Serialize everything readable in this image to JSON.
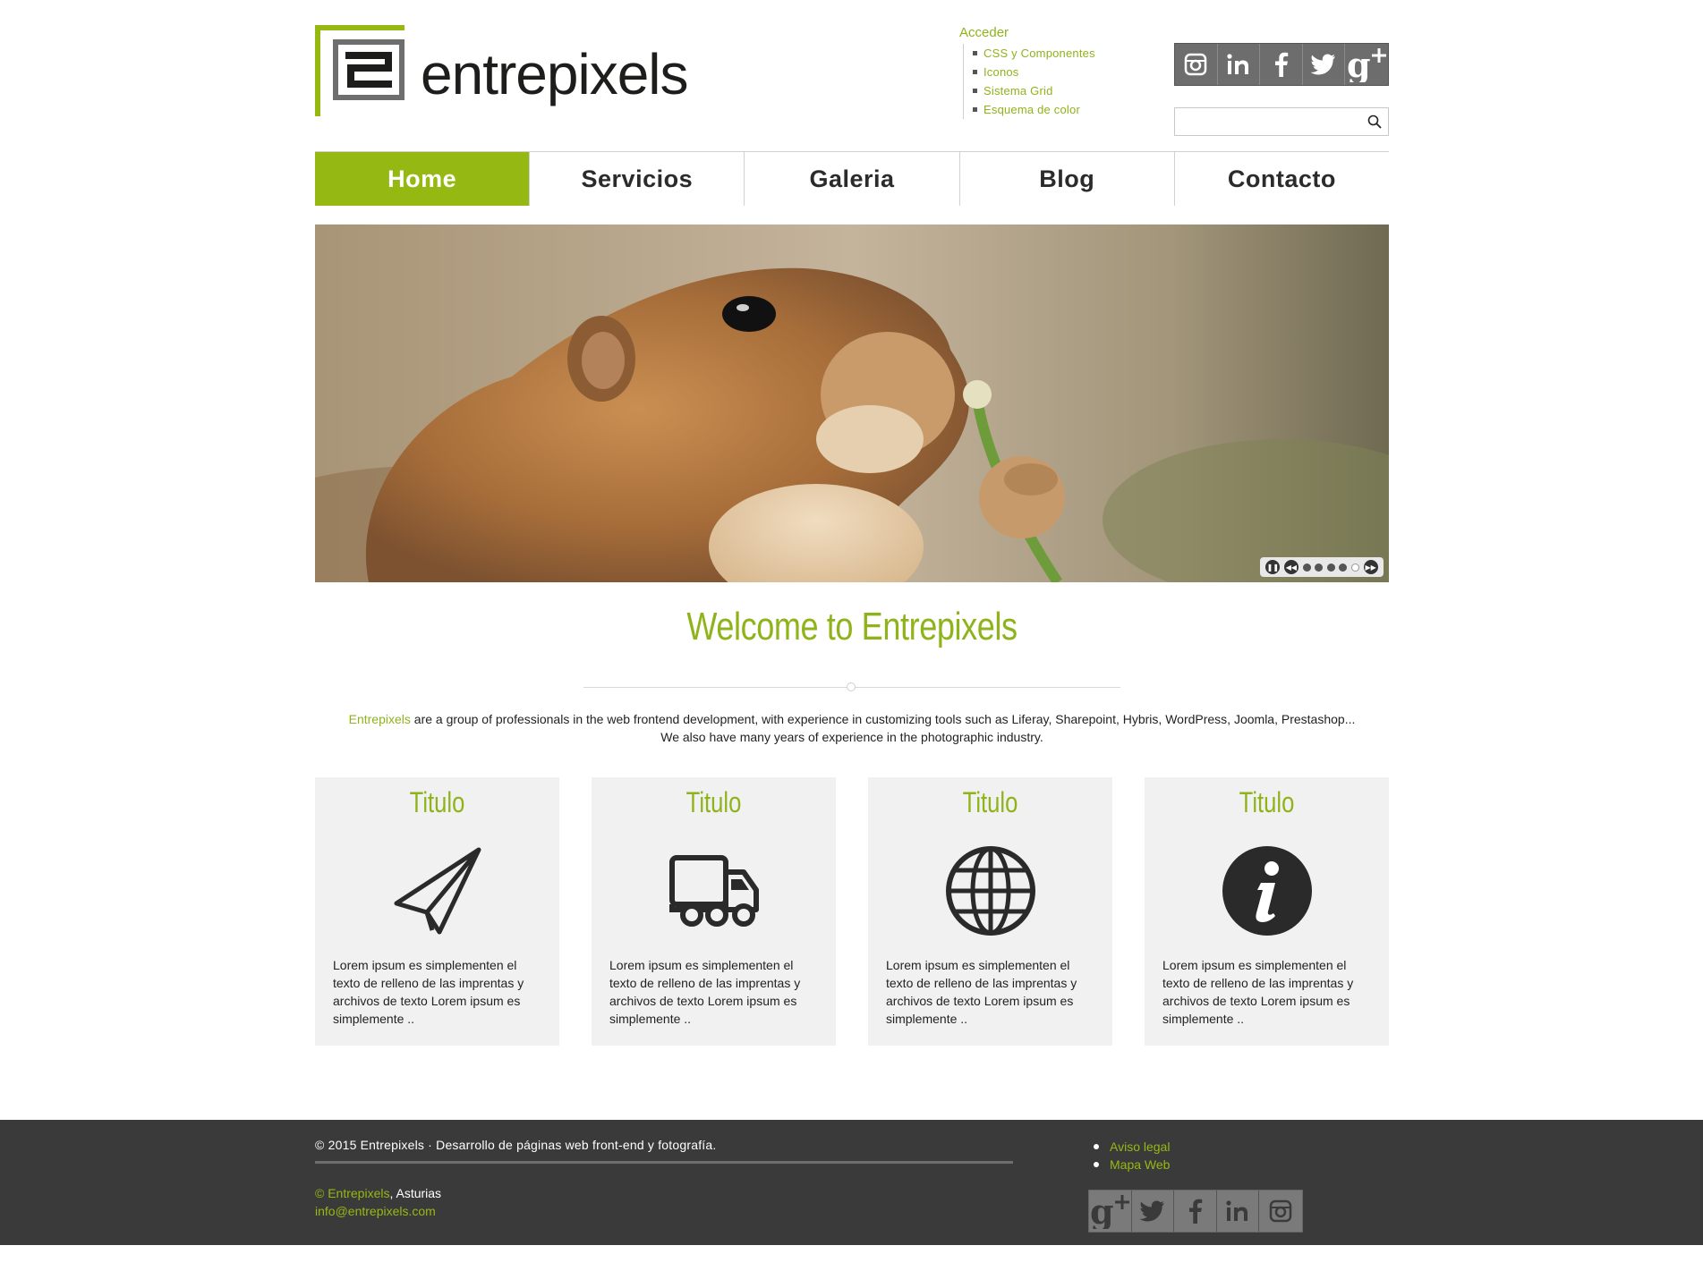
{
  "brand": {
    "name": "entrepixels",
    "accent": "#96b813"
  },
  "access": {
    "title": "Acceder",
    "items": [
      "CSS y Componentes",
      "Iconos",
      "Sistema Grid",
      "Esquema de color"
    ]
  },
  "social_top": [
    "instagram-icon",
    "linkedin-icon",
    "facebook-icon",
    "twitter-icon",
    "google-plus-icon"
  ],
  "search": {
    "placeholder": "",
    "value": ""
  },
  "nav": {
    "items": [
      "Home",
      "Servicios",
      "Galeria",
      "Blog",
      "Contacto"
    ],
    "active": "Home"
  },
  "slider": {
    "total_slides": 5,
    "active_slide": 5
  },
  "welcome": {
    "title": "Welcome to Entrepixels",
    "intro_highlight": "Entrepixels",
    "intro_rest": " are a group of professionals in the web frontend development, with experience in customizing tools such as Liferay, Sharepoint, Hybris, WordPress, Joomla, Prestashop...",
    "intro_line2": "We also have many years of experience in the photographic industry."
  },
  "features": [
    {
      "title": "Titulo",
      "icon": "paper-plane-icon",
      "text": "Lorem ipsum es simplementen el texto de relleno de las imprentas y archivos de texto Lorem ipsum es simplemente .."
    },
    {
      "title": "Titulo",
      "icon": "truck-icon",
      "text": "Lorem ipsum es simplementen el texto de relleno de las imprentas y archivos de texto Lorem ipsum es simplemente .."
    },
    {
      "title": "Titulo",
      "icon": "globe-icon",
      "text": "Lorem ipsum es simplementen el texto de relleno de las imprentas y archivos de texto Lorem ipsum es simplemente .."
    },
    {
      "title": "Titulo",
      "icon": "info-icon",
      "text": "Lorem ipsum es simplementen el texto de relleno de las imprentas y archivos de texto Lorem ipsum es simplemente .."
    }
  ],
  "footer": {
    "copyright": "© 2015 Entrepixels · Desarrollo de páginas web front-end y fotografía.",
    "addr_brand": "© Entrepixels",
    "addr_place": ", Asturias",
    "email": "info@entrepixels.com",
    "links": [
      "Aviso legal",
      "Mapa Web"
    ],
    "social": [
      "google-plus-icon",
      "twitter-icon",
      "facebook-icon",
      "linkedin-icon",
      "instagram-icon"
    ]
  }
}
